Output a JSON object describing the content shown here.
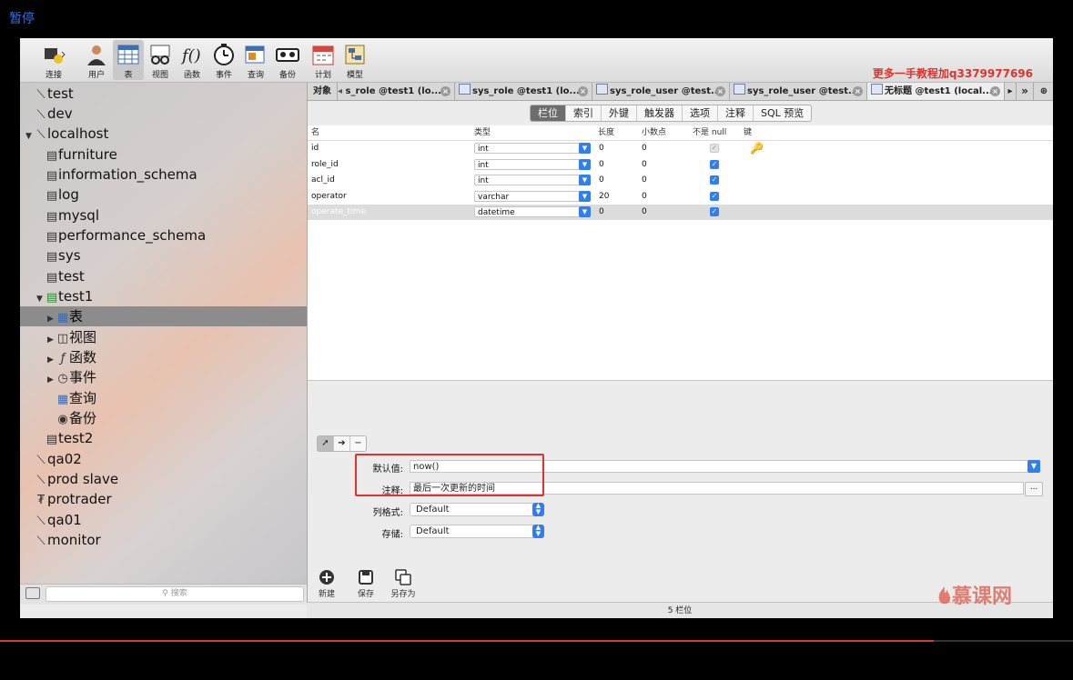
{
  "pause_label": "暂停",
  "promo_text": "更多一手教程加q3379977696",
  "toolbar": {
    "buttons": [
      {
        "label": "连接",
        "icon": "connect-icon"
      },
      {
        "label": "用户",
        "icon": "user-icon"
      },
      {
        "label": "表",
        "icon": "table-icon"
      },
      {
        "label": "视图",
        "icon": "view-icon"
      },
      {
        "label": "函数",
        "icon": "function-icon"
      },
      {
        "label": "事件",
        "icon": "event-icon"
      },
      {
        "label": "查询",
        "icon": "query-icon"
      },
      {
        "label": "备份",
        "icon": "backup-icon"
      },
      {
        "label": "计划",
        "icon": "schedule-icon"
      },
      {
        "label": "模型",
        "icon": "model-icon"
      }
    ],
    "active_index": 2
  },
  "sidebar": {
    "items": [
      {
        "label": "test",
        "icon": "connection-icon"
      },
      {
        "label": "dev",
        "icon": "connection-icon"
      },
      {
        "label": "localhost",
        "icon": "connection-icon"
      },
      {
        "label": "furniture",
        "icon": "database-icon"
      },
      {
        "label": "information_schema",
        "icon": "database-icon"
      },
      {
        "label": "log",
        "icon": "database-icon"
      },
      {
        "label": "mysql",
        "icon": "database-icon"
      },
      {
        "label": "performance_schema",
        "icon": "database-icon"
      },
      {
        "label": "sys",
        "icon": "database-icon"
      },
      {
        "label": "test",
        "icon": "database-icon"
      },
      {
        "label": "test1",
        "icon": "database-icon"
      },
      {
        "label": "表",
        "icon": "table-icon"
      },
      {
        "label": "视图",
        "icon": "view-icon"
      },
      {
        "label": "函数",
        "icon": "function-icon"
      },
      {
        "label": "事件",
        "icon": "event-icon"
      },
      {
        "label": "查询",
        "icon": "query-icon"
      },
      {
        "label": "备份",
        "icon": "backup-icon"
      },
      {
        "label": "test2",
        "icon": "database-icon"
      },
      {
        "label": "qa02",
        "icon": "connection-icon"
      },
      {
        "label": "prod slave",
        "icon": "connection-icon"
      },
      {
        "label": "protrader",
        "icon": "connection-icon"
      },
      {
        "label": "qa01",
        "icon": "connection-icon"
      },
      {
        "label": "monitor",
        "icon": "connection-icon"
      }
    ],
    "selected_label": "表",
    "search_placeholder": "搜索"
  },
  "tabs": {
    "object_tab": "对象",
    "items": [
      "s_role @test1 (lo...",
      "sys_role @test1 (lo...",
      "sys_role_user @test...",
      "sys_role_user @test...",
      "无标题 @test1 (local..."
    ],
    "overflow": "»"
  },
  "segments": [
    "栏位",
    "索引",
    "外键",
    "触发器",
    "选项",
    "注释",
    "SQL 预览"
  ],
  "grid": {
    "headers": [
      "名",
      "类型",
      "长度",
      "小数点",
      "不是 null",
      "键"
    ],
    "rows": [
      {
        "name": "id",
        "type": "int",
        "length": "0",
        "decimals": "0",
        "not_null": "✓"
      },
      {
        "name": "role_id",
        "type": "int",
        "length": "0",
        "decimals": "0",
        "not_null": "✓"
      },
      {
        "name": "acl_id",
        "type": "int",
        "length": "0",
        "decimals": "0",
        "not_null": "✓"
      },
      {
        "name": "operator",
        "type": "varchar",
        "length": "20",
        "decimals": "0",
        "not_null": "✓"
      },
      {
        "name": "operate_time",
        "type": "datetime",
        "length": "0",
        "decimals": "0",
        "not_null": "✓"
      }
    ]
  },
  "props": {
    "default_label": "默认值:",
    "default_value": "now()",
    "comment_label": "注释:",
    "comment_value": "最后一次更新的时间",
    "format_label": "列格式:",
    "format_value": "Default",
    "storage_label": "存储:",
    "storage_value": "Default",
    "ellipsis": "..."
  },
  "actions": [
    {
      "label": "新建",
      "icon": "new-icon"
    },
    {
      "label": "保存",
      "icon": "save-icon"
    },
    {
      "label": "另存为",
      "icon": "save-as-icon"
    }
  ],
  "status": "5 栏位",
  "logo_text": "慕课网",
  "colors": {
    "accent": "#2f7ff2",
    "highlight": "#e0312c",
    "progress": "#d63a2f"
  },
  "video_progress": 0.87
}
